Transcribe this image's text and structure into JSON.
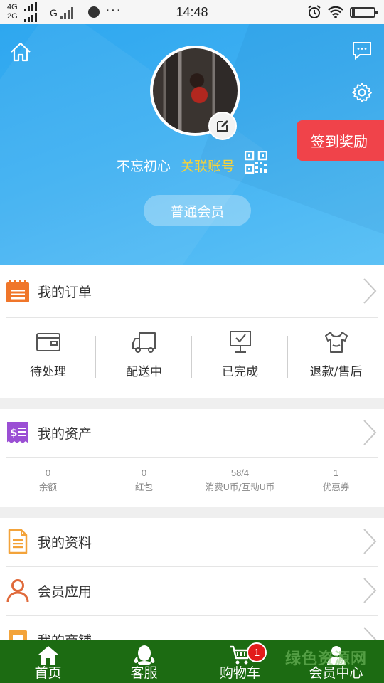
{
  "status_bar": {
    "network_top": "4G",
    "network_bottom": "2G",
    "network_g": "G",
    "time": "14:48",
    "more": "···"
  },
  "header": {
    "nickname": "不忘初心",
    "link_account": "关联账号",
    "member_level": "普通会员",
    "signin_label": "签到奖励",
    "link_color": "#f7d238",
    "signin_color": "#f0434a"
  },
  "orders": {
    "title": "我的订单",
    "items": [
      {
        "label": "待处理",
        "icon": "wallet-icon"
      },
      {
        "label": "配送中",
        "icon": "truck-icon"
      },
      {
        "label": "已完成",
        "icon": "monitor-check-icon"
      },
      {
        "label": "退款/售后",
        "icon": "return-shirt-icon"
      }
    ]
  },
  "assets": {
    "title": "我的资产",
    "items": [
      {
        "value": "0",
        "label": "余额"
      },
      {
        "value": "0",
        "label": "红包"
      },
      {
        "value": "58/4",
        "label": "消费U币/互动U币"
      },
      {
        "value": "1",
        "label": "优惠券"
      }
    ]
  },
  "menu": {
    "profile": "我的资料",
    "member_apps": "会员应用",
    "shop": "我的商铺"
  },
  "bottom_nav": {
    "items": [
      {
        "label": "首页",
        "icon": "home-icon"
      },
      {
        "label": "客服",
        "icon": "customer-service-icon"
      },
      {
        "label": "购物车",
        "icon": "cart-icon"
      },
      {
        "label": "会员中心",
        "icon": "user-icon"
      }
    ],
    "cart_count": "1",
    "bar_color": "#1c6b12"
  },
  "watermark": "绿色资源网"
}
